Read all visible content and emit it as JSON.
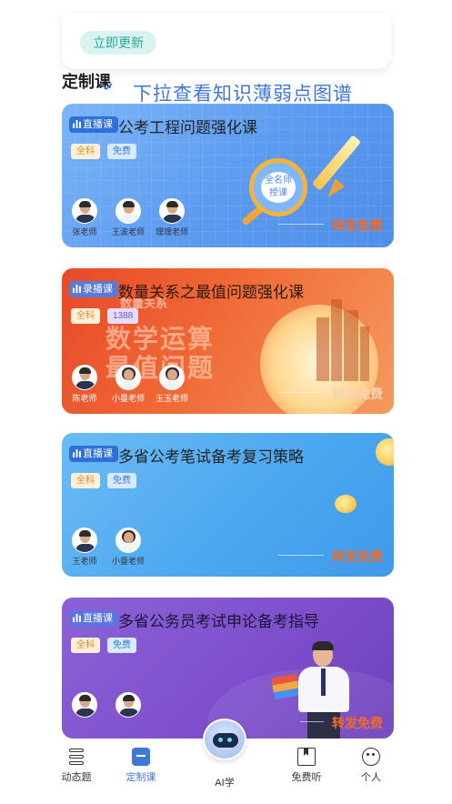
{
  "update": {
    "button_label": "立即更新"
  },
  "section": {
    "title": "定制课",
    "pull_hint": "下拉查看知识薄弱点图谱"
  },
  "courses": [
    {
      "type_tag": "直播课",
      "title": "公考工程问题强化课",
      "subject": "全科",
      "price_tag": "免费",
      "badge_text": "全名师授课",
      "share_label": "转发免费",
      "teachers": [
        {
          "name": "张老师",
          "gender": "male"
        },
        {
          "name": "王波老师",
          "gender": "male"
        },
        {
          "name": "理理老师",
          "gender": "male"
        }
      ]
    },
    {
      "type_tag": "录播课",
      "title": "数量关系之最值问题强化课",
      "subtitle_art": "数量关系",
      "subject": "全科",
      "price_tag": "1388",
      "art_line_1": "数学运算",
      "art_line_2": "最值问题",
      "share_label": "转发免费",
      "teachers": [
        {
          "name": "陈老师",
          "gender": "male"
        },
        {
          "name": "小曼老师",
          "gender": "female"
        },
        {
          "name": "玉玉老师",
          "gender": "female"
        }
      ]
    },
    {
      "type_tag": "直播课",
      "title": "多省公考笔试备考复习策略",
      "subject": "全科",
      "price_tag": "免费",
      "share_label": "转发免费",
      "teachers": [
        {
          "name": "王老师",
          "gender": "male"
        },
        {
          "name": "小曼老师",
          "gender": "female"
        }
      ]
    },
    {
      "type_tag": "直播课",
      "title": "多省公务员考试申论备考指导",
      "subject": "全科",
      "price_tag": "免费",
      "share_label": "转发免费",
      "teachers": [
        {
          "name": "",
          "gender": "male"
        },
        {
          "name": "",
          "gender": "male"
        }
      ]
    }
  ],
  "tabbar": {
    "items": [
      {
        "label": "动态题",
        "icon": "stack-icon"
      },
      {
        "label": "定制课",
        "icon": "course-icon",
        "active": true
      },
      {
        "label": "AI学",
        "icon": "robot-icon"
      },
      {
        "label": "免费听",
        "icon": "book-icon"
      },
      {
        "label": "个人",
        "icon": "face-icon"
      }
    ]
  },
  "colors": {
    "accent": "#3f78d6",
    "share": "#f06a2a",
    "update_bg": "#d8f4f1"
  }
}
